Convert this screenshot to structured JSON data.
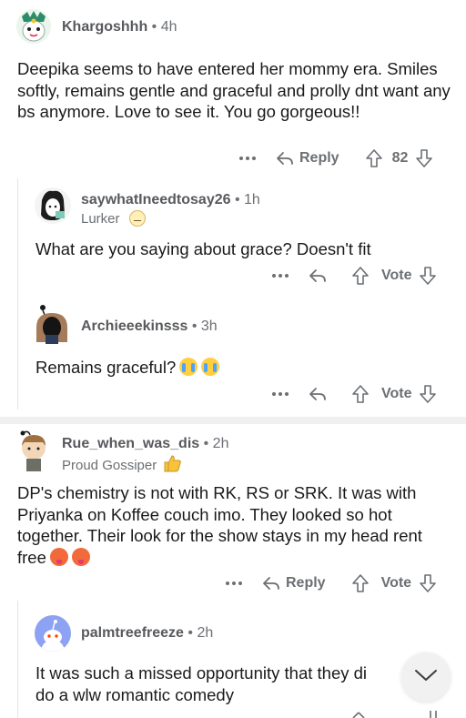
{
  "comments": [
    {
      "username": "Khargoshhh",
      "meta": " • 4h",
      "body": "Deepika seems to have entered her mommy era. Smiles softly, remains gentle and graceful and prolly dnt want any bs anymore. Love to see it. You go gorgeous!!",
      "reply_label": "Reply",
      "vote_count": "82"
    },
    {
      "username": "saywhatIneedtosay26",
      "meta": " • 1h",
      "flair": "Lurker",
      "body": "What are you saying about grace? Doesn't fit",
      "vote_label": "Vote"
    },
    {
      "username": "Archieeekinsss",
      "meta": " • 3h",
      "body": "Remains graceful?",
      "vote_label": "Vote"
    },
    {
      "username": "Rue_when_was_dis",
      "meta": " • 2h",
      "flair": "Proud Gossiper",
      "body": "DP's chemistry is not with RK, RS or SRK. It was with Priyanka on Koffee couch imo. They looked so hot together. Their look for the show stays in my head rent free",
      "reply_label": "Reply",
      "vote_label": "Vote"
    },
    {
      "username": "palmtreefreeze",
      "meta": " • 2h",
      "body": "It was such a missed opportunity that they di\ndo a wlw romantic comedy"
    }
  ],
  "colors": {
    "text": "#1a1a1b",
    "muted": "#6c6f73",
    "thread_line": "#e3e3e3",
    "separator": "#f0f0f0",
    "avatar_snoo": "#8da2f2"
  },
  "icons": [
    "overflow-icon",
    "reply-icon",
    "upvote-icon",
    "downvote-icon",
    "chevron-down-icon"
  ]
}
